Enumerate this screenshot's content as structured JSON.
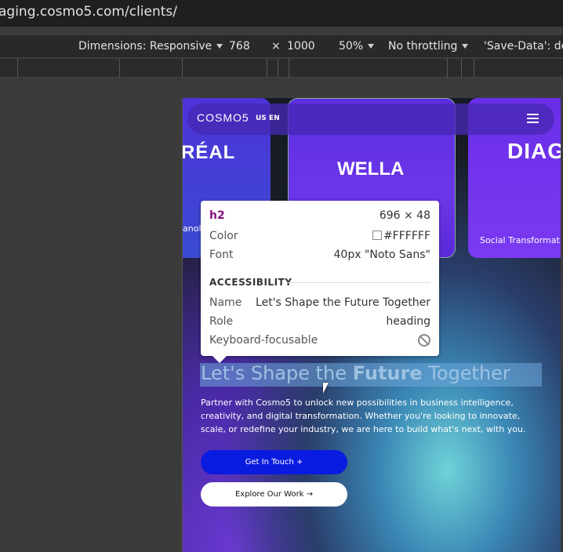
{
  "browser": {
    "url": "aging.cosmo5.com/clients/"
  },
  "device_toolbar": {
    "dimensions_label": "Dimensions: Responsive",
    "width": "768",
    "times": "×",
    "height": "1000",
    "zoom": "50%",
    "throttling": "No throttling",
    "save_data": "'Save-Data': def"
  },
  "site": {
    "logo": "COSMO5",
    "lang": "US EN",
    "cards": [
      {
        "brand": "RÉAL",
        "caption": "anolo"
      },
      {
        "brand": "WELLA",
        "caption": ""
      },
      {
        "brand": "DIAG",
        "caption": "Social Transformat"
      }
    ],
    "headline_pre": "Let's Shape the ",
    "headline_bold": "Future",
    "headline_post": " Together",
    "paragraph": "Partner with Cosmo5 to unlock new possibilities in business intelligence, creativity, and digital transformation. Whether you're looking to innovate, scale, or redefine your industry, we are here to build what's next, with you.",
    "primary_button": "Get In Touch  +",
    "secondary_button": "Explore Our Work  →"
  },
  "inspector": {
    "tag": "h2",
    "size": "696 × 48",
    "color_label": "Color",
    "color_value": "#FFFFFF",
    "font_label": "Font",
    "font_value": "40px \"Noto Sans\"",
    "accessibility_title": "ACCESSIBILITY",
    "name_label": "Name",
    "name_value": "Let's Shape the Future Together",
    "role_label": "Role",
    "role_value": "heading",
    "focus_label": "Keyboard-focusable"
  }
}
